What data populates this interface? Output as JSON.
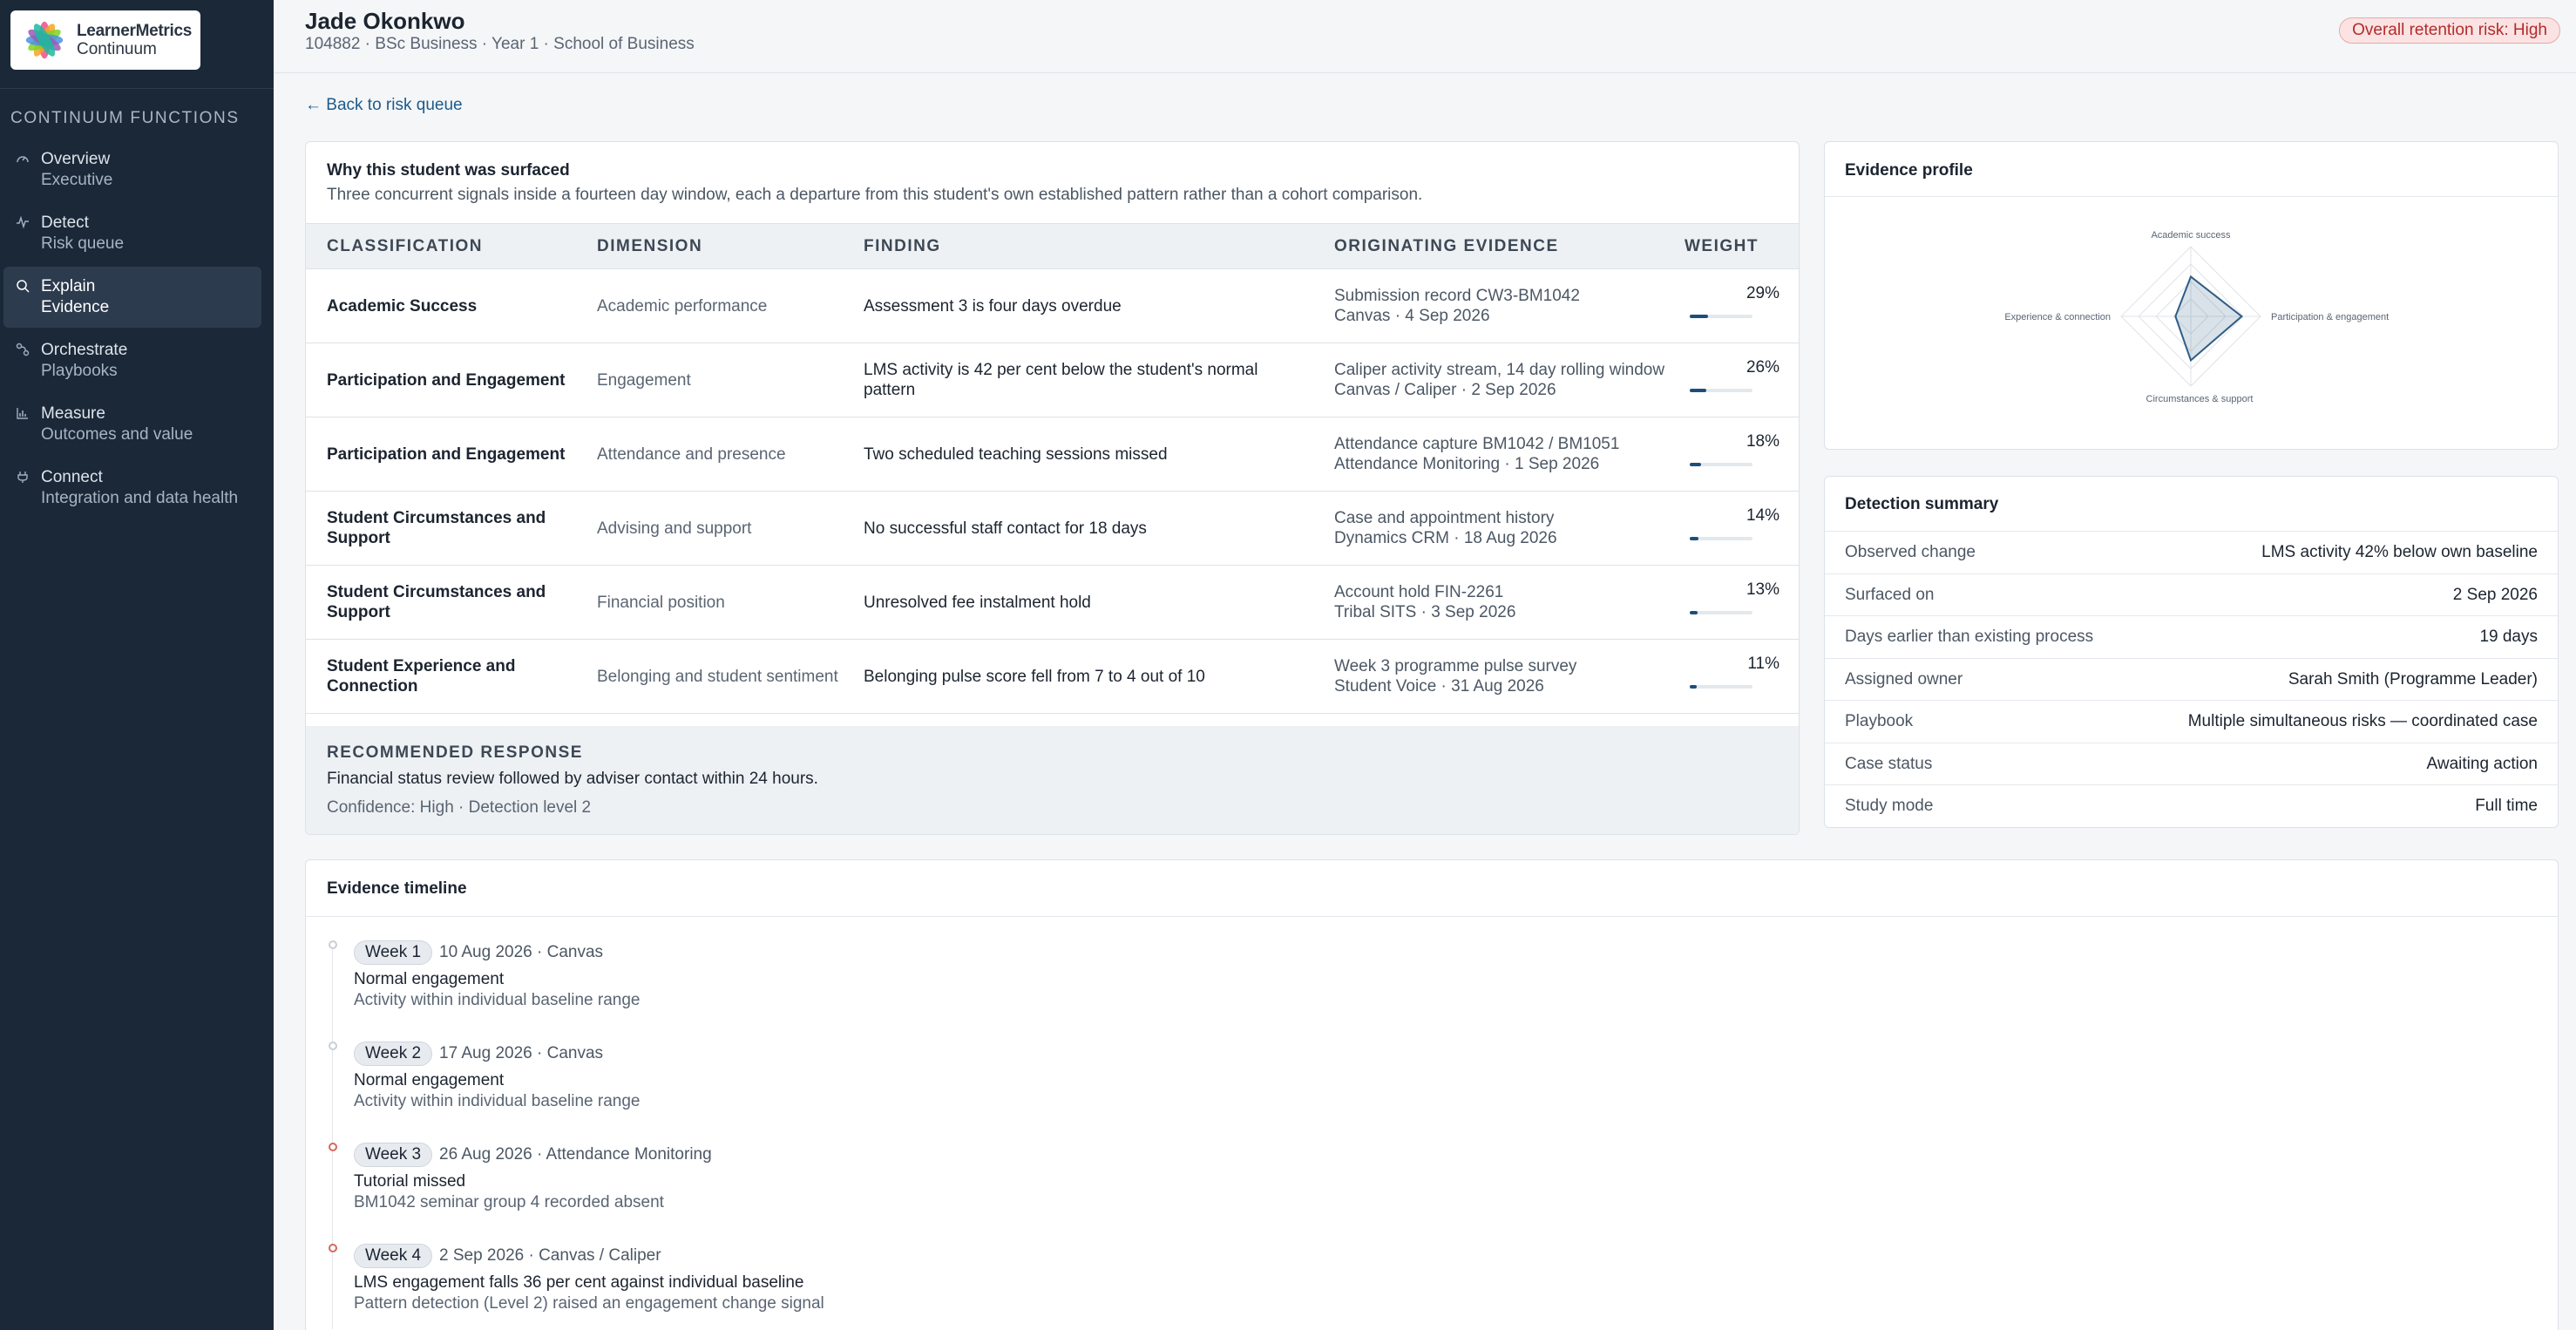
{
  "sidebar": {
    "logo_line1": "LearnerMetrics",
    "logo_line2": "Continuum",
    "heading": "CONTINUUM FUNCTIONS",
    "items": [
      {
        "title": "Overview",
        "sub": "Executive",
        "icon": "gauge-icon"
      },
      {
        "title": "Detect",
        "sub": "Risk queue",
        "icon": "pulse-icon"
      },
      {
        "title": "Explain",
        "sub": "Evidence",
        "icon": "search-icon"
      },
      {
        "title": "Orchestrate",
        "sub": "Playbooks",
        "icon": "workflow-icon"
      },
      {
        "title": "Measure",
        "sub": "Outcomes and value",
        "icon": "bar-chart-icon"
      },
      {
        "title": "Connect",
        "sub": "Integration and data health",
        "icon": "plug-icon"
      }
    ],
    "active_index": 2
  },
  "header": {
    "name": "Jade Okonkwo",
    "meta": "104882 · BSc Business · Year 1 · School of Business",
    "risk_badge": "Overall retention risk: High"
  },
  "back_link": "← Back to risk queue",
  "why": {
    "title": "Why this student was surfaced",
    "description": "Three concurrent signals inside a fourteen day window, each a departure from this student's own established pattern rather than a cohort comparison.",
    "columns": [
      "CLASSIFICATION",
      "DIMENSION",
      "FINDING",
      "ORIGINATING EVIDENCE",
      "WEIGHT"
    ],
    "rows": [
      {
        "classification": "Academic Success",
        "dimension": "Academic performance",
        "finding": "Assessment 3 is four days overdue",
        "evidence_1": "Submission record CW3-BM1042",
        "evidence_2": "Canvas · 4 Sep 2026",
        "weight": "29%",
        "weight_value": 0.29
      },
      {
        "classification": "Participation and Engagement",
        "dimension": "Engagement",
        "finding": "LMS activity is 42 per cent below the student's normal pattern",
        "evidence_1": "Caliper activity stream, 14 day rolling window",
        "evidence_2": "Canvas / Caliper · 2 Sep 2026",
        "weight": "26%",
        "weight_value": 0.26
      },
      {
        "classification": "Participation and Engagement",
        "dimension": "Attendance and presence",
        "finding": "Two scheduled teaching sessions missed",
        "evidence_1": "Attendance capture BM1042 / BM1051",
        "evidence_2": "Attendance Monitoring · 1 Sep 2026",
        "weight": "18%",
        "weight_value": 0.18
      },
      {
        "classification": "Student Circumstances and Support",
        "dimension": "Advising and support",
        "finding": "No successful staff contact for 18 days",
        "evidence_1": "Case and appointment history",
        "evidence_2": "Dynamics CRM · 18 Aug 2026",
        "weight": "14%",
        "weight_value": 0.14
      },
      {
        "classification": "Student Circumstances and Support",
        "dimension": "Financial position",
        "finding": "Unresolved fee instalment hold",
        "evidence_1": "Account hold FIN-2261",
        "evidence_2": "Tribal SITS · 3 Sep 2026",
        "weight": "13%",
        "weight_value": 0.13
      },
      {
        "classification": "Student Experience and Connection",
        "dimension": "Belonging and student sentiment",
        "finding": "Belonging pulse score fell from 7 to 4 out of 10",
        "evidence_1": "Week 3 programme pulse survey",
        "evidence_2": "Student Voice · 31 Aug 2026",
        "weight": "11%",
        "weight_value": 0.11
      }
    ],
    "recommended_label": "RECOMMENDED RESPONSE",
    "recommended_text": "Financial status review followed by adviser contact within 24 hours.",
    "confidence": "Confidence: High · Detection level 2"
  },
  "profile": {
    "title": "Evidence profile",
    "axes": [
      "Academic success",
      "Participation & engagement",
      "Circumstances & support",
      "Experience & connection"
    ],
    "values": [
      0.57,
      0.73,
      0.63,
      0.22
    ],
    "accent": "#2f5d86"
  },
  "detection": {
    "title": "Detection summary",
    "rows": [
      {
        "label": "Observed change",
        "value": "LMS activity 42% below own baseline"
      },
      {
        "label": "Surfaced on",
        "value": "2 Sep 2026"
      },
      {
        "label": "Days earlier than existing process",
        "value": "19 days"
      },
      {
        "label": "Assigned owner",
        "value": "Sarah Smith (Programme Leader)"
      },
      {
        "label": "Playbook",
        "value": "Multiple simultaneous risks — coordinated case"
      },
      {
        "label": "Case status",
        "value": "Awaiting action"
      },
      {
        "label": "Study mode",
        "value": "Full time"
      }
    ]
  },
  "timeline": {
    "title": "Evidence timeline",
    "items": [
      {
        "week": "Week 1",
        "date": "10 Aug 2026",
        "source": "· Canvas",
        "title": "Normal engagement",
        "desc": "Activity within individual baseline range",
        "alert": false
      },
      {
        "week": "Week 2",
        "date": "17 Aug 2026",
        "source": "· Canvas",
        "title": "Normal engagement",
        "desc": "Activity within individual baseline range",
        "alert": false
      },
      {
        "week": "Week 3",
        "date": "26 Aug 2026",
        "source": "· Attendance Monitoring",
        "title": "Tutorial missed",
        "desc": "BM1042 seminar group 4 recorded absent",
        "alert": true
      },
      {
        "week": "Week 4",
        "date": "2 Sep 2026",
        "source": "· Canvas / Caliper",
        "title": "LMS engagement falls 36 per cent against individual baseline",
        "desc": "Pattern detection (Level 2) raised an engagement change signal",
        "alert": true
      }
    ]
  }
}
